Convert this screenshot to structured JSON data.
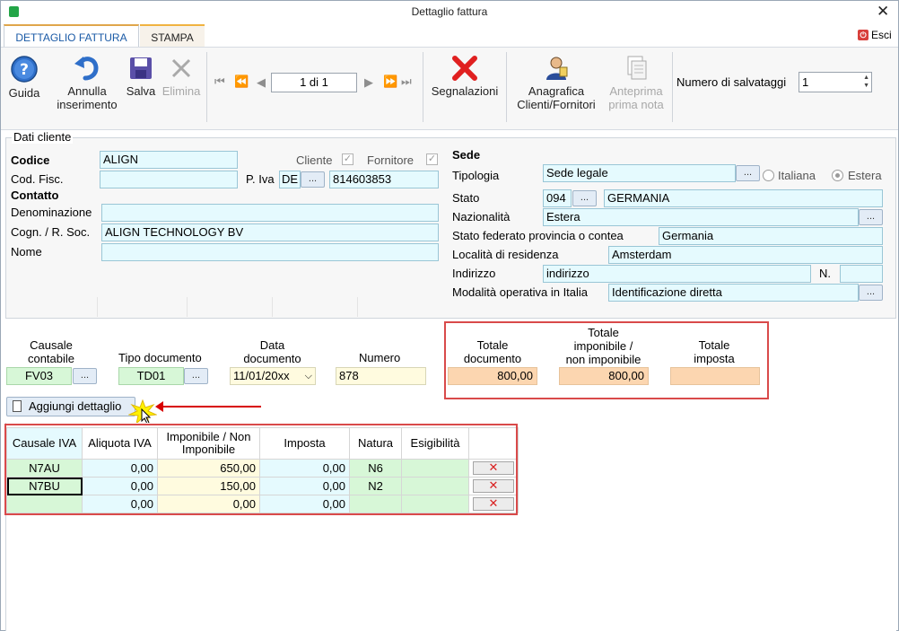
{
  "window": {
    "title": "Dettaglio fattura",
    "close_glyph": "✕"
  },
  "tabs": [
    {
      "label": "DETTAGLIO FATTURA",
      "active": true
    },
    {
      "label": "STAMPA",
      "active": false
    }
  ],
  "exit": {
    "label": "Esci"
  },
  "toolbar": {
    "guida": "Guida",
    "annulla_1": "Annulla",
    "annulla_2": "inserimento",
    "salva": "Salva",
    "elimina": "Elimina",
    "pager": "1 di 1",
    "segnalazioni": "Segnalazioni",
    "anagrafica_1": "Anagrafica",
    "anagrafica_2": "Clienti/Fornitori",
    "anteprima_1": "Anteprima",
    "anteprima_2": "prima nota",
    "salvataggi_label": "Numero di salvataggi",
    "salvataggi_value": "1"
  },
  "cliente": {
    "group_title": "Dati cliente",
    "codice_label": "Codice",
    "codice_value": "ALIGN",
    "cliente_label": "Cliente",
    "fornitore_label": "Fornitore",
    "codfisc_label": "Cod. Fisc.",
    "codfisc_value": "",
    "piva_label": "P. Iva",
    "piva_country": "DE",
    "piva_value": "814603853",
    "contatto_label": "Contatto",
    "denominazione_label": "Denominazione",
    "denominazione_value": "",
    "cognome_label": "Cogn. / R. Soc.",
    "cognome_value": "ALIGN TECHNOLOGY BV",
    "nome_label": "Nome",
    "nome_value": ""
  },
  "sede": {
    "title": "Sede",
    "tipologia_label": "Tipologia",
    "tipologia_value": "Sede legale",
    "italiana_label": "Italiana",
    "estera_label": "Estera",
    "stato_label": "Stato",
    "stato_code": "094",
    "stato_value": "GERMANIA",
    "nazionalita_label": "Nazionalità",
    "nazionalita_value": "Estera",
    "provincia_label": "Stato federato provincia o contea",
    "provincia_value": "Germania",
    "localita_label": "Località di residenza",
    "localita_value": "Amsterdam",
    "indirizzo_label": "Indirizzo",
    "indirizzo_value": "indirizzo",
    "numero_label": "N.",
    "numero_value": "",
    "modalita_label": "Modalità operativa in Italia",
    "modalita_value": "Identificazione diretta"
  },
  "documento": {
    "causale_label_1": "Causale",
    "causale_label_2": "contabile",
    "causale_value": "FV03",
    "tipo_label": "Tipo documento",
    "tipo_value": "TD01",
    "data_label_1": "Data",
    "data_label_2": "documento",
    "data_value": "11/01/20xx",
    "numero_label": "Numero",
    "numero_value": "878",
    "tot_doc_label_1": "Totale",
    "tot_doc_label_2": "documento",
    "tot_doc_value": "800,00",
    "tot_imp_label_1": "Totale",
    "tot_imp_label_2": "imponibile /",
    "tot_imp_label_3": "non imponibile",
    "tot_imp_value": "800,00",
    "tot_iva_label_1": "Totale",
    "tot_iva_label_2": "imposta",
    "tot_iva_value": ""
  },
  "dettaglio": {
    "add_label": "Aggiungi dettaglio",
    "columns": [
      "Causale IVA",
      "Aliquota IVA",
      "Imponibile / Non Imponibile",
      "Imposta",
      "Natura",
      "Esigibilità"
    ],
    "rows": [
      {
        "causale": "N7AU",
        "aliquota": "0,00",
        "imponibile": "650,00",
        "imposta": "0,00",
        "natura": "N6",
        "esigibilita": ""
      },
      {
        "causale": "N7BU",
        "aliquota": "0,00",
        "imponibile": "150,00",
        "imposta": "0,00",
        "natura": "N2",
        "esigibilita": ""
      },
      {
        "causale": "",
        "aliquota": "0,00",
        "imponibile": "0,00",
        "imposta": "0,00",
        "natura": "",
        "esigibilita": ""
      }
    ],
    "delete_glyph": "✕"
  },
  "colors": {
    "accent": "#1a5aa6",
    "highlight_red": "#d94a4a",
    "field_cyan": "#e5fafe",
    "field_green": "#d7f7d7",
    "field_peach": "#fcd6b0"
  }
}
